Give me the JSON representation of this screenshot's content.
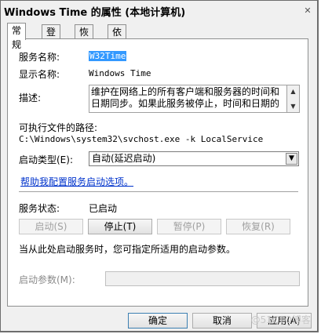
{
  "window": {
    "title": "Windows Time 的属性 (本地计算机)"
  },
  "tabs": [
    {
      "label": "常规"
    },
    {
      "label": "登录"
    },
    {
      "label": "恢复"
    },
    {
      "label": "依存关系"
    }
  ],
  "general": {
    "service_name_label": "服务名称:",
    "service_name_value": "W32Time",
    "display_name_label": "显示名称:",
    "display_name_value": "Windows Time",
    "description_label": "描述:",
    "description_value": "维护在网络上的所有客户端和服务器的时间和日期同步。如果此服务被停止，时间和日期的",
    "exe_path_label": "可执行文件的路径:",
    "exe_path_value": "C:\\Windows\\system32\\svchost.exe -k LocalService",
    "startup_type_label": "启动类型(E):",
    "startup_type_value": "自动(延迟启动)",
    "help_link": "帮助我配置服务启动选项。",
    "status_label": "服务状态:",
    "status_value": "已启动",
    "buttons": {
      "start": "启动(S)",
      "stop": "停止(T)",
      "pause": "暂停(P)",
      "resume": "恢复(R)"
    },
    "hint": "当从此处启动服务时，您可指定所适用的启动参数。",
    "params_label": "启动参数(M):"
  },
  "footer": {
    "ok": "确定",
    "cancel": "取消",
    "apply": "应用(A)"
  },
  "watermark": "@51CTO博客"
}
